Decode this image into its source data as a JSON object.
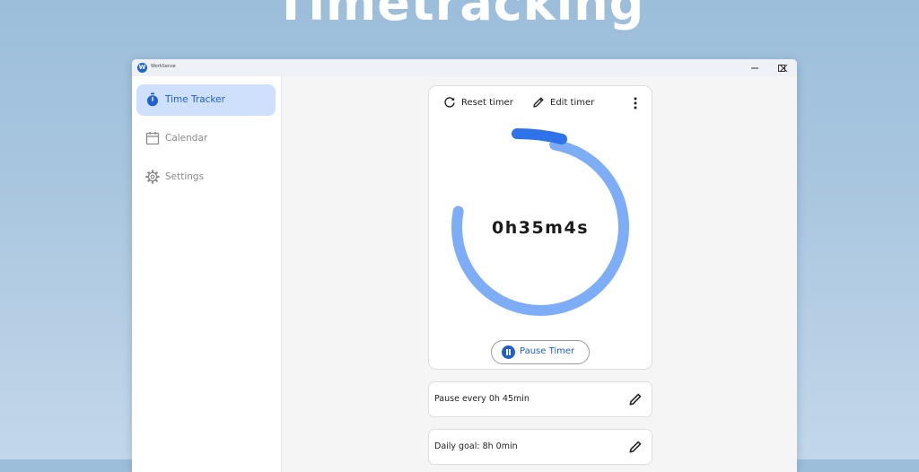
{
  "hero": {
    "title": "Timetracking"
  },
  "window": {
    "app_name": "WorkSense"
  },
  "sidebar": {
    "items": [
      {
        "label": "Time Tracker",
        "icon": "stopwatch-icon",
        "active": true
      },
      {
        "label": "Calendar",
        "icon": "calendar-icon",
        "active": false
      },
      {
        "label": "Settings",
        "icon": "gear-icon",
        "active": false
      }
    ]
  },
  "timer_card": {
    "reset_label": "Reset timer",
    "edit_label": "Edit timer",
    "time_display": "0h35m4s",
    "pause_label": "Pause Timer",
    "progress_fraction": 0.78
  },
  "settings": {
    "pause_interval": "Pause every 0h 45min",
    "daily_goal": "Daily goal: 8h 0min"
  },
  "colors": {
    "accent": "#1f5fd1",
    "ring_light": "#7eadf7",
    "ring_dark": "#2f73ea",
    "active_nav_bg": "#cfe0fd"
  }
}
